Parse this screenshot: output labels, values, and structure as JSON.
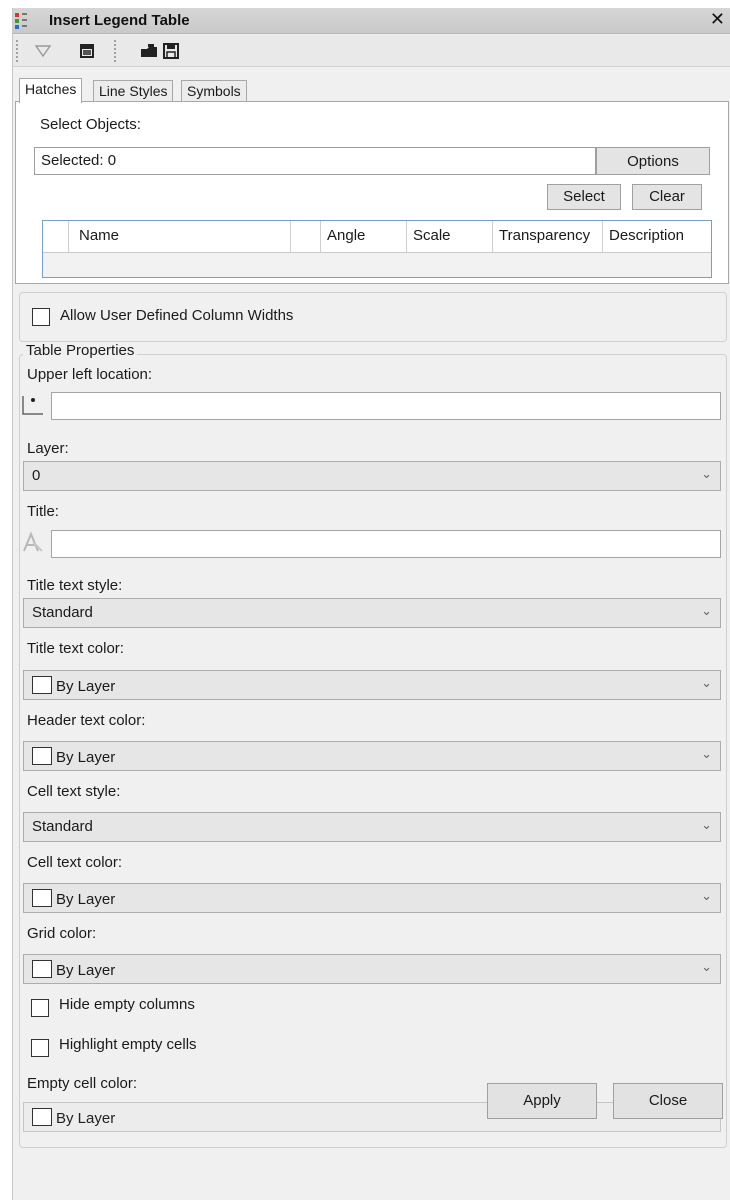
{
  "window": {
    "title": "Insert Legend Table"
  },
  "toolbar": {
    "icons": [
      "filter-icon",
      "window-icon",
      "open-folder-icon",
      "save-icon"
    ]
  },
  "tabs": [
    {
      "label": "Hatches",
      "active": true
    },
    {
      "label": "Line Styles",
      "active": false
    },
    {
      "label": "Symbols",
      "active": false
    }
  ],
  "hatches": {
    "select_objects_label": "Select Objects:",
    "selected_text": "Selected: 0",
    "options_label": "Options",
    "select_label": "Select",
    "clear_label": "Clear",
    "columns": [
      "Name",
      "Angle",
      "Scale",
      "Transparency",
      "Description"
    ]
  },
  "allow_column_widths_label": "Allow User Defined Column Widths",
  "table_properties": {
    "legend": "Table Properties",
    "upper_left_label": "Upper left location:",
    "upper_left_value": "",
    "layer_label": "Layer:",
    "layer_value": "0",
    "title_label": "Title:",
    "title_value": "",
    "title_text_style_label": "Title text style:",
    "title_text_style_value": "Standard",
    "title_text_color_label": "Title text color:",
    "title_text_color_value": "By Layer",
    "header_text_color_label": "Header text color:",
    "header_text_color_value": "By Layer",
    "cell_text_style_label": "Cell text style:",
    "cell_text_style_value": "Standard",
    "cell_text_color_label": "Cell text color:",
    "cell_text_color_value": "By Layer",
    "grid_color_label": "Grid color:",
    "grid_color_value": "By Layer",
    "hide_empty_columns_label": "Hide empty columns",
    "highlight_empty_cells_label": "Highlight empty cells",
    "empty_cell_color_label": "Empty cell color:",
    "empty_cell_color_value": "By Layer"
  },
  "footer": {
    "apply_label": "Apply",
    "close_label": "Close"
  },
  "colors": {
    "panel_bg": "#f0f0f0",
    "grid_border": "#7a9dc9"
  }
}
